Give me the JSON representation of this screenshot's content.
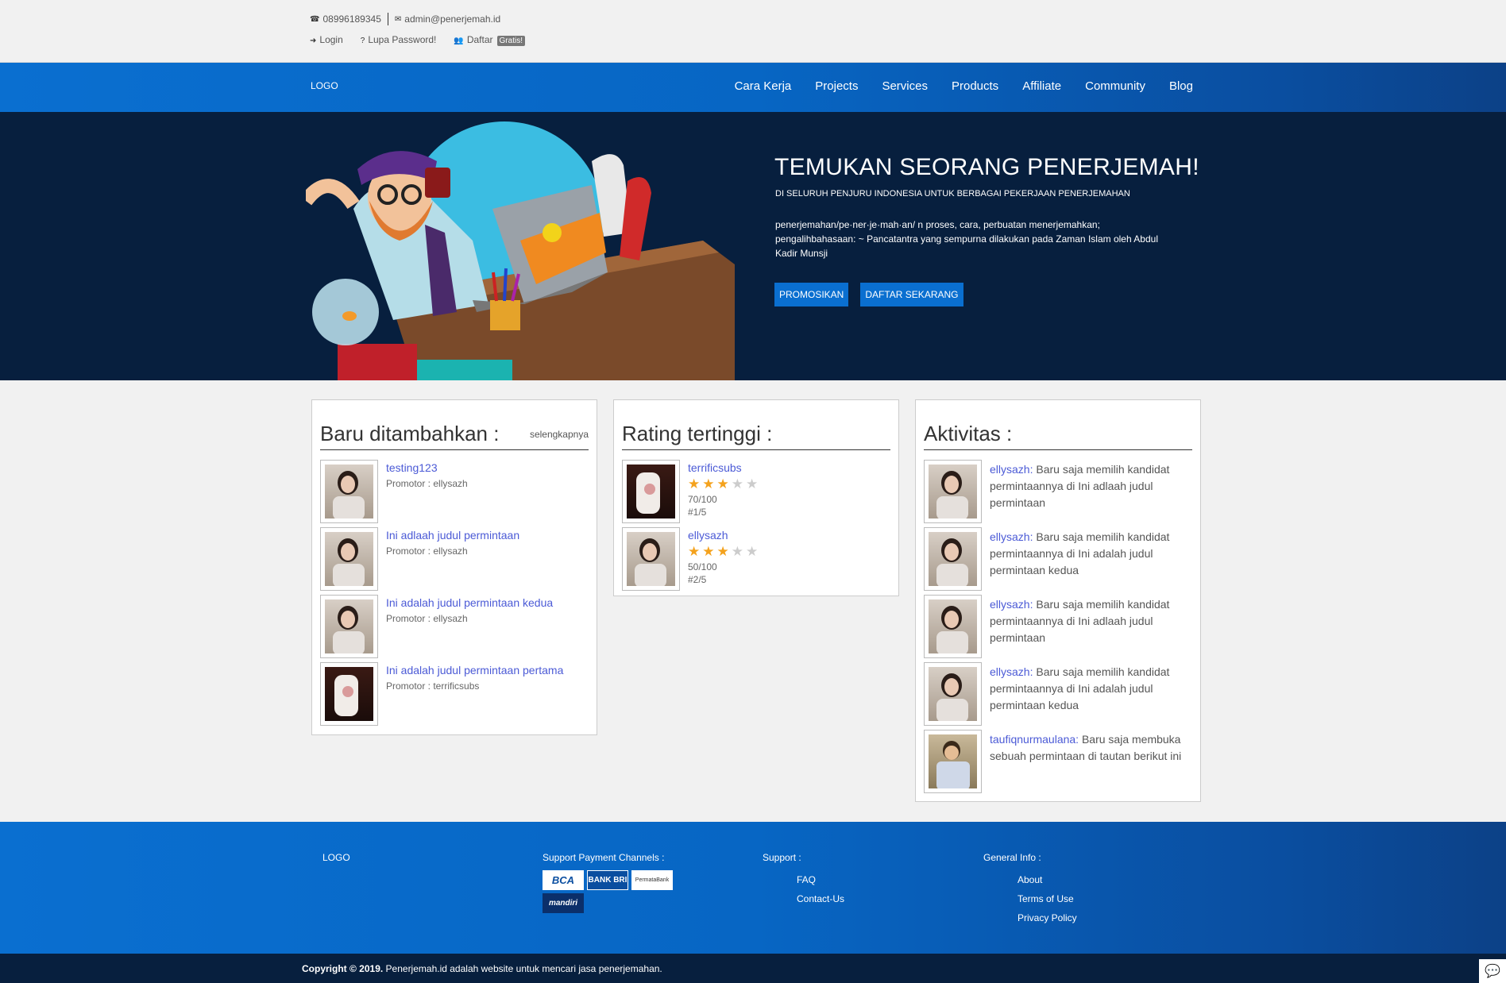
{
  "topbar": {
    "phone": "08996189345",
    "email": "admin@penerjemah.id",
    "login": "Login",
    "forgot": "Lupa Password!",
    "register": "Daftar",
    "register_badge": "Gratis!"
  },
  "nav": {
    "logo": "LOGO",
    "items": [
      "Cara Kerja",
      "Projects",
      "Services",
      "Products",
      "Affiliate",
      "Community",
      "Blog"
    ]
  },
  "hero": {
    "title": "TEMUKAN SEORANG PENERJEMAH!",
    "subtitle": "DI SELURUH PENJURU INDONESIA UNTUK BERBAGAI PEKERJAAN PENERJEMAHAN",
    "definition": "penerjemahan/pe·ner·je·mah·an/ n proses, cara, perbuatan menerjemahkan; pengalihbahasaan: ~ Pancatantra yang sempurna dilakukan pada Zaman Islam oleh Abdul Kadir Munsji",
    "btn_promote": "PROMOSIKAN",
    "btn_register": "DAFTAR SEKARANG"
  },
  "recent": {
    "title": "Baru ditambahkan :",
    "more": "selengkapnya",
    "items": [
      {
        "title": "testing123",
        "meta": "Promotor : ellysazh"
      },
      {
        "title": "Ini adlaah judul permintaan",
        "meta": "Promotor : ellysazh"
      },
      {
        "title": "Ini adalah judul permintaan kedua",
        "meta": "Promotor : ellysazh"
      },
      {
        "title": "Ini adalah judul permintaan pertama",
        "meta": "Promotor : terrificsubs"
      }
    ]
  },
  "rating": {
    "title": "Rating tertinggi :",
    "items": [
      {
        "name": "terrificsubs",
        "stars": 3,
        "score": "70/100",
        "rank": "#1/5"
      },
      {
        "name": "ellysazh",
        "stars": 3,
        "score": "50/100",
        "rank": "#2/5"
      }
    ]
  },
  "activity": {
    "title": "Aktivitas :",
    "items": [
      {
        "user": "ellysazh:",
        "text": " Baru saja memilih kandidat permintaannya di Ini adlaah judul permintaan"
      },
      {
        "user": "ellysazh:",
        "text": " Baru saja memilih kandidat permintaannya di Ini adalah judul permintaan kedua"
      },
      {
        "user": "ellysazh:",
        "text": " Baru saja memilih kandidat permintaannya di Ini adlaah judul permintaan"
      },
      {
        "user": "ellysazh:",
        "text": " Baru saja memilih kandidat permintaannya di Ini adalah judul permintaan kedua"
      },
      {
        "user": "taufiqnurmaulana:",
        "text": " Baru saja membuka sebuah permintaan di tautan berikut ini"
      }
    ]
  },
  "footer": {
    "logo": "LOGO",
    "payment_title": "Support Payment Channels :",
    "payment_logos": [
      "BCA",
      "BANK BRI",
      "PermataBank",
      "mandiri"
    ],
    "support_title": "Support :",
    "support_links": [
      "FAQ",
      "Contact-Us"
    ],
    "info_title": "General Info :",
    "info_links": [
      "About",
      "Terms of Use",
      "Privacy Policy"
    ]
  },
  "copyright": {
    "bold": "Copyright © 2019.",
    "text": " Penerjemah.id adalah website untuk mencari jasa penerjemahan."
  },
  "colors": {
    "brand_blue": "#0a6fd0",
    "dark_navy": "#071f3e",
    "link": "#4b5ad6",
    "star": "#f4a21d"
  }
}
